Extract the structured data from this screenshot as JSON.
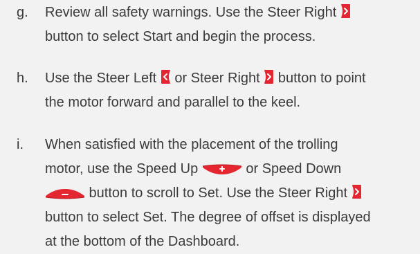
{
  "steps": [
    {
      "letter": "g.",
      "lines": [
        [
          "Review all safety warnings. Use the Steer Right ",
          {
            "icon": "steer-right-icon"
          },
          ""
        ],
        [
          "button to select Start and begin the process."
        ]
      ]
    },
    {
      "letter": "h.",
      "lines": [
        [
          "Use the Steer Left ",
          {
            "icon": "steer-left-icon"
          },
          " or Steer Right ",
          {
            "icon": "steer-right-icon"
          },
          " button to point"
        ],
        [
          "the motor forward and parallel to the keel."
        ]
      ]
    },
    {
      "letter": "i.",
      "lines": [
        [
          "When satisfied with the placement of the trolling"
        ],
        [
          "motor, use the Speed Up ",
          {
            "icon": "speed-up-icon"
          },
          " or Speed Down"
        ],
        [
          {
            "icon": "speed-down-icon"
          },
          " button to scroll to Set. Use the Steer Right ",
          {
            "icon": "steer-right-icon"
          },
          ""
        ],
        [
          "button to select Set. The degree of offset is displayed"
        ],
        [
          "at the bottom of the Dashboard."
        ]
      ]
    }
  ],
  "colors": {
    "text": "#3a3a3a",
    "background": "#f2f2f2",
    "button_red": "#e3262f",
    "button_dark_red": "#b81c23"
  }
}
